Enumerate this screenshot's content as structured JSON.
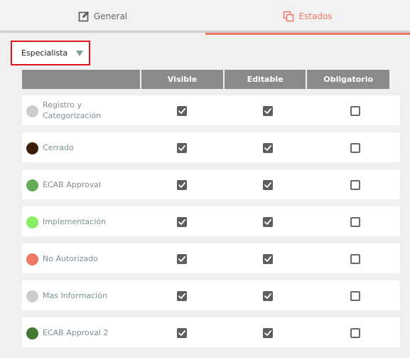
{
  "tabs": {
    "general": {
      "label": "General",
      "icon": "edit-icon"
    },
    "estados": {
      "label": "Estados",
      "icon": "copy-icon",
      "active": true,
      "color": "#f07a68"
    }
  },
  "role_select": {
    "value": "Especialista"
  },
  "table": {
    "columns": [
      "",
      "Visible",
      "Editable",
      "Obligatorio"
    ],
    "rows": [
      {
        "label": "Registro y Categorización",
        "color": "#cccccc",
        "visible": true,
        "editable": true,
        "obligatorio": false
      },
      {
        "label": "Cerrado",
        "color": "#3a1f0a",
        "visible": true,
        "editable": true,
        "obligatorio": false
      },
      {
        "label": "ECAB Approval",
        "color": "#66aa55",
        "visible": true,
        "editable": true,
        "obligatorio": false
      },
      {
        "label": "Implementación",
        "color": "#88ee66",
        "visible": true,
        "editable": true,
        "obligatorio": false
      },
      {
        "label": "No Autorizado",
        "color": "#ee7766",
        "visible": true,
        "editable": true,
        "obligatorio": false
      },
      {
        "label": "Mas Información",
        "color": "#cccccc",
        "visible": true,
        "editable": true,
        "obligatorio": false
      },
      {
        "label": "ECAB Approval 2",
        "color": "#447733",
        "visible": true,
        "editable": true,
        "obligatorio": false
      }
    ]
  }
}
